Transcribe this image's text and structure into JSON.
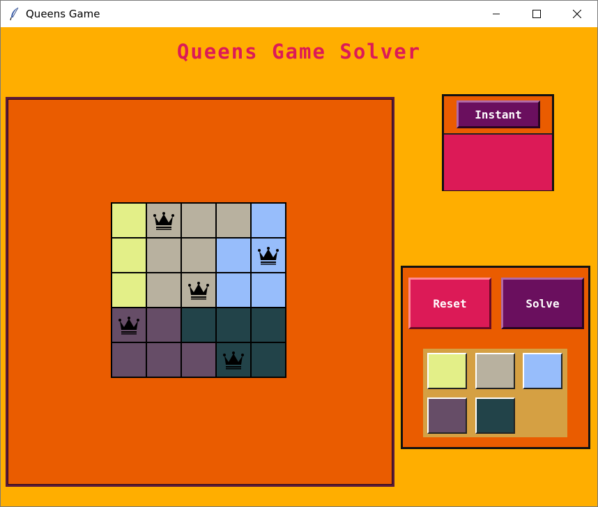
{
  "window": {
    "title": "Queens Game",
    "controls": [
      "minimize-icon",
      "maximize-icon",
      "close-icon"
    ]
  },
  "app": {
    "heading": "Queens Game Solver"
  },
  "colors": {
    "background": "#ffae00",
    "panel": "#ea5c00",
    "accent_pink": "#dc1a57",
    "accent_purple": "#6a0f5e",
    "palette_bg": "#d5a043"
  },
  "region_colors": {
    "yellow": "#e3ef88",
    "gray": "#b8b19f",
    "blue": "#97bdfb",
    "purple": "#664d67",
    "teal": "#224349"
  },
  "board": {
    "size": 5,
    "cell_regions": [
      [
        "yellow",
        "gray",
        "gray",
        "gray",
        "blue"
      ],
      [
        "yellow",
        "gray",
        "gray",
        "blue",
        "blue"
      ],
      [
        "yellow",
        "gray",
        "gray",
        "blue",
        "blue"
      ],
      [
        "purple",
        "purple",
        "teal",
        "teal",
        "teal"
      ],
      [
        "purple",
        "purple",
        "purple",
        "teal",
        "teal"
      ]
    ],
    "queens": [
      [
        0,
        1
      ],
      [
        1,
        4
      ],
      [
        2,
        2
      ],
      [
        3,
        0
      ],
      [
        4,
        3
      ]
    ],
    "queen_icon": "crown-icon"
  },
  "speed": {
    "instant_label": "Instant"
  },
  "controls": {
    "reset_label": "Reset",
    "solve_label": "Solve"
  },
  "palette": [
    "yellow",
    "gray",
    "blue",
    "purple",
    "teal"
  ]
}
